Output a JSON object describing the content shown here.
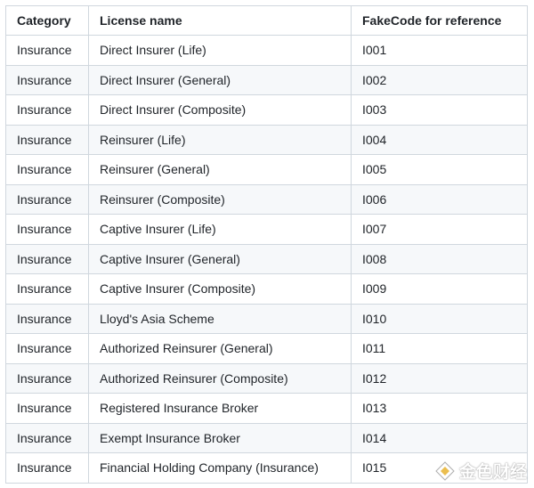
{
  "table": {
    "headers": [
      "Category",
      "License name",
      "FakeCode for reference"
    ],
    "rows": [
      [
        "Insurance",
        "Direct Insurer (Life)",
        "I001"
      ],
      [
        "Insurance",
        "Direct Insurer (General)",
        "I002"
      ],
      [
        "Insurance",
        "Direct Insurer (Composite)",
        "I003"
      ],
      [
        "Insurance",
        "Reinsurer (Life)",
        "I004"
      ],
      [
        "Insurance",
        "Reinsurer (General)",
        "I005"
      ],
      [
        "Insurance",
        "Reinsurer (Composite)",
        "I006"
      ],
      [
        "Insurance",
        "Captive Insurer (Life)",
        "I007"
      ],
      [
        "Insurance",
        "Captive Insurer (General)",
        "I008"
      ],
      [
        "Insurance",
        "Captive Insurer (Composite)",
        "I009"
      ],
      [
        "Insurance",
        "Lloyd's Asia Scheme",
        "I010"
      ],
      [
        "Insurance",
        "Authorized Reinsurer (General)",
        "I011"
      ],
      [
        "Insurance",
        "Authorized Reinsurer (Composite)",
        "I012"
      ],
      [
        "Insurance",
        "Registered Insurance Broker",
        "I013"
      ],
      [
        "Insurance",
        "Exempt Insurance Broker",
        "I014"
      ],
      [
        "Insurance",
        "Financial Holding Company (Insurance)",
        "I015"
      ]
    ]
  },
  "watermark": {
    "text": "金色财经",
    "icon": "jinse-logo-icon"
  }
}
